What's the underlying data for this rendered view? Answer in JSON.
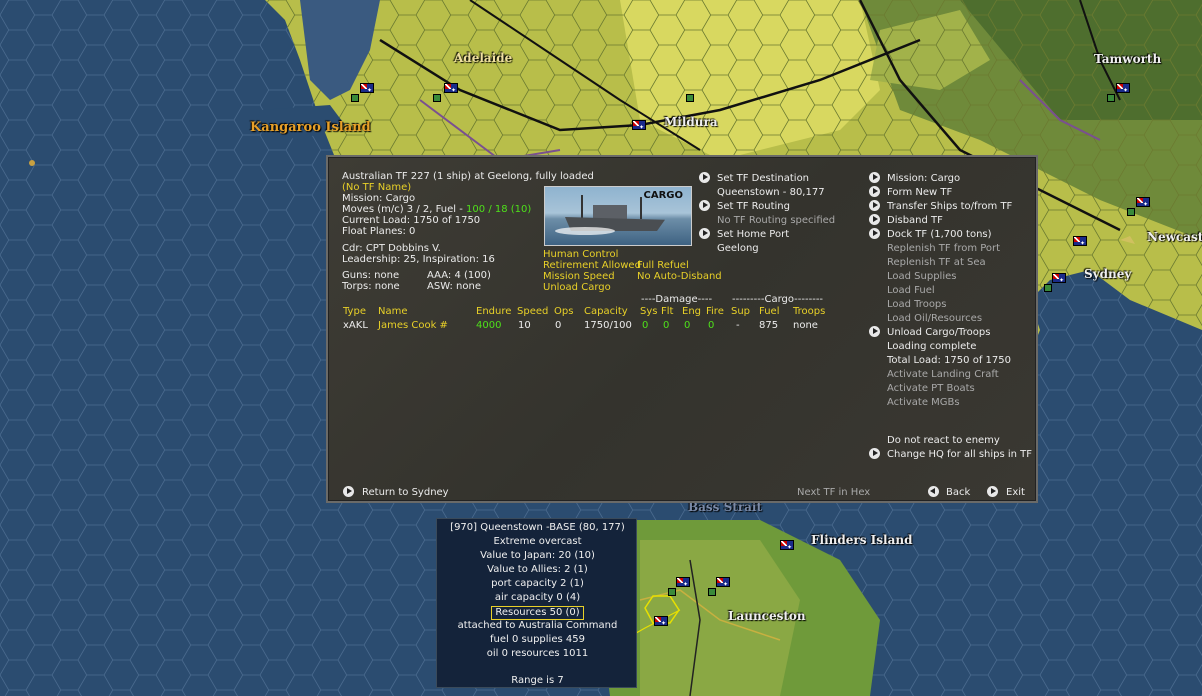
{
  "map": {
    "labels": {
      "adelaide": "Adelaide",
      "kangaroo_island": "Kangaroo Island",
      "mildura": "Mildura",
      "tamworth": "Tamworth",
      "newcastle": "Newcastl",
      "sydney": "Sydney",
      "bass_strait": "Bass Strait",
      "flinders_island": "Flinders Island",
      "launceston": "Launceston"
    }
  },
  "tf_panel": {
    "header": "Australian TF 227 (1 ship) at Geelong, fully loaded",
    "tf_name": "(No TF Name)",
    "mission": "Mission: Cargo",
    "moves_prefix": "Moves (m/c)  3 / 2, Fuel - ",
    "moves_fuel": "100 / 18 (10)",
    "current_load": "Current Load:  1750 of 1750",
    "float_planes": "Float Planes:  0",
    "commander": "Cdr: CPT  Dobbins V.",
    "leadership": "Leadership: 25, Inspiration: 16",
    "guns": "Guns: none",
    "aaa": "AAA: 4 (100)",
    "torps": "Torps: none",
    "asw": "ASW: none",
    "ship_image_label": "CARGO",
    "flags": {
      "human_control": "Human Control",
      "retirement": "Retirement Allowed",
      "full_refuel": "Full Refuel",
      "mission_speed": "Mission Speed",
      "no_auto_disband": "No Auto-Disband",
      "unload_cargo": "Unload Cargo"
    },
    "nav": {
      "set_destination": "Set TF Destination",
      "destination_value": "Queenstown - 80,177",
      "set_routing": "Set TF Routing",
      "routing_value": "No TF Routing specified",
      "set_home_port": "Set Home Port",
      "home_port_value": "Geelong"
    },
    "table": {
      "damage_group": "----Damage----",
      "cargo_group": "---------Cargo--------",
      "headers": {
        "type": "Type",
        "name": "Name",
        "endure": "Endure",
        "speed": "Speed",
        "ops": "Ops",
        "capacity": "Capacity",
        "sys": "Sys",
        "flt": "Flt",
        "eng": "Eng",
        "fire": "Fire",
        "sup": "Sup",
        "fuel": "Fuel",
        "troops": "Troops"
      },
      "row": {
        "type": "xAKL",
        "name": "James Cook #",
        "endure": "4000",
        "speed": "10",
        "ops": "0",
        "capacity": "1750/100",
        "sys": "0",
        "flt": "0",
        "eng": "0",
        "fire": "0",
        "sup": "-",
        "fuel": "875",
        "troops": "none"
      }
    },
    "menu": {
      "mission_cargo": "Mission: Cargo",
      "form_new_tf": "Form New TF",
      "transfer_ships": "Transfer Ships to/from TF",
      "disband_tf": "Disband TF",
      "dock_tf": "Dock TF (1,700 tons)",
      "replenish_port": "Replenish TF from Port",
      "replenish_sea": "Replenish TF at Sea",
      "load_supplies": "Load Supplies",
      "load_fuel": "Load Fuel",
      "load_troops": "Load Troops",
      "load_oil": "Load Oil/Resources",
      "unload_cargo": "Unload Cargo/Troops",
      "loading_complete": "Loading complete",
      "total_load": "Total Load: 1750 of 1750",
      "activate_landing": "Activate Landing Craft",
      "activate_pt": "Activate PT Boats",
      "activate_mgb": "Activate MGBs",
      "do_not_react": "Do not react to enemy",
      "change_hq": "Change HQ for all ships in TF"
    },
    "footer": {
      "return": "Return to Sydney",
      "next_tf": "Next TF in Hex",
      "back": "Back",
      "exit": "Exit"
    }
  },
  "hex_info": {
    "title": "[970] Queenstown  -BASE  (80, 177)",
    "weather": "Extreme overcast",
    "value_japan": "Value to Japan: 20 (10)",
    "value_allies": "Value to Allies:  2 (1)",
    "port_capacity": "port capacity 2 (1)",
    "air_capacity": "air capacity 0 (4)",
    "resources": "Resources  50 (0)",
    "attached": "attached to Australia Command",
    "fuel_supplies": "fuel 0  supplies 459",
    "oil_resources": "oil 0  resources 1011",
    "range": "Range is 7"
  },
  "colors": {
    "ocean": "#2a4a6e",
    "panel": "#3a3832",
    "highlight_yellow": "#e8d028",
    "highlight_green": "#4ee01a"
  }
}
